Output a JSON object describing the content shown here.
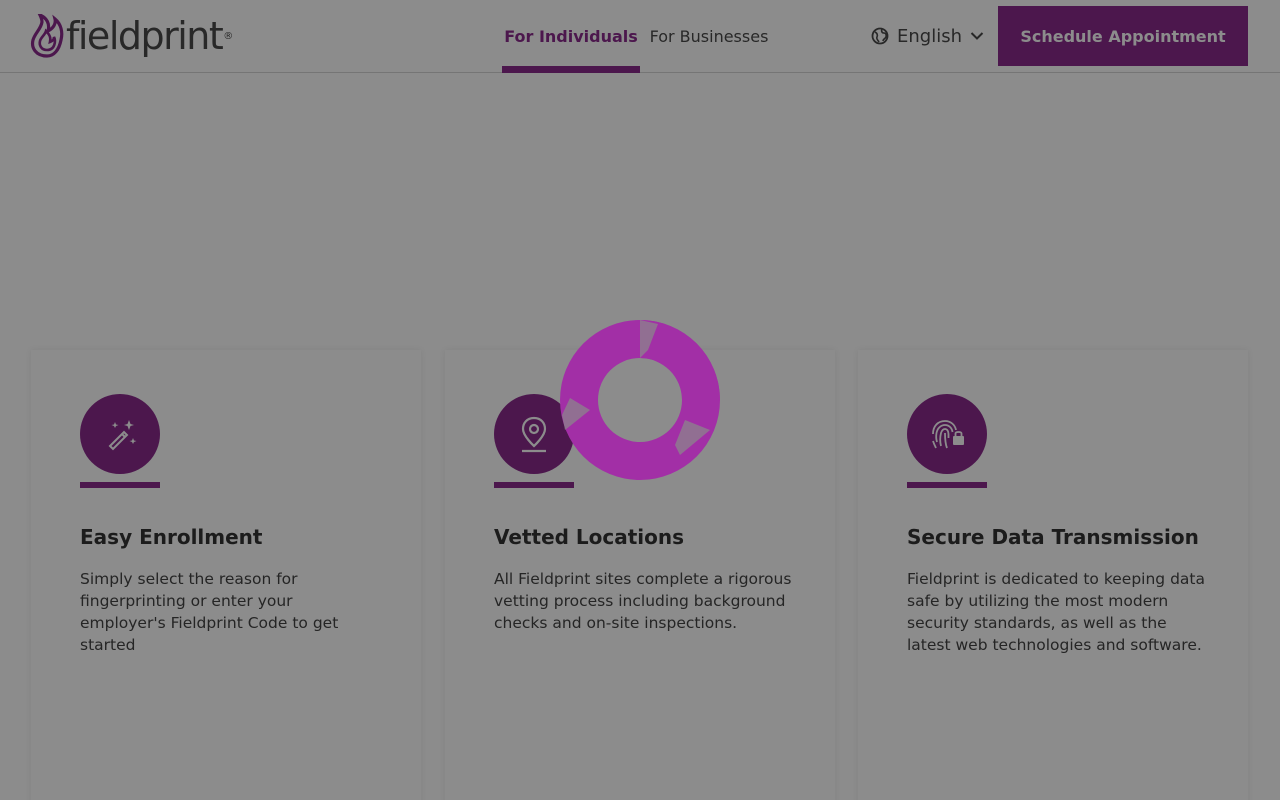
{
  "brand": {
    "name": "fieldprint",
    "accent_color": "#8a2a8d"
  },
  "nav": {
    "tabs": [
      {
        "label": "For Individuals",
        "active": true
      },
      {
        "label": "For Businesses",
        "active": false
      }
    ],
    "language": {
      "icon": "globe-icon",
      "label": "English",
      "chevron": "chevron-down-icon"
    },
    "cta_label": "Schedule Appointment"
  },
  "cards": [
    {
      "icon": "magic-wand-icon",
      "title": "Easy Enrollment",
      "description": "Simply select the reason for fingerprinting or enter your employer's Fieldprint Code to get started"
    },
    {
      "icon": "location-pin-icon",
      "title": "Vetted Locations",
      "description": "All Fieldprint sites complete a rigorous vetting process including background checks and on-site inspections."
    },
    {
      "icon": "fingerprint-lock-icon",
      "title": "Secure Data Transmission",
      "description": "Fieldprint is dedicated to keeping data safe by utilizing the most modern security standards, as well as the latest web technologies and software."
    }
  ],
  "loading": {
    "icon": "loading-spinner-icon",
    "color": "#a22fa6"
  }
}
